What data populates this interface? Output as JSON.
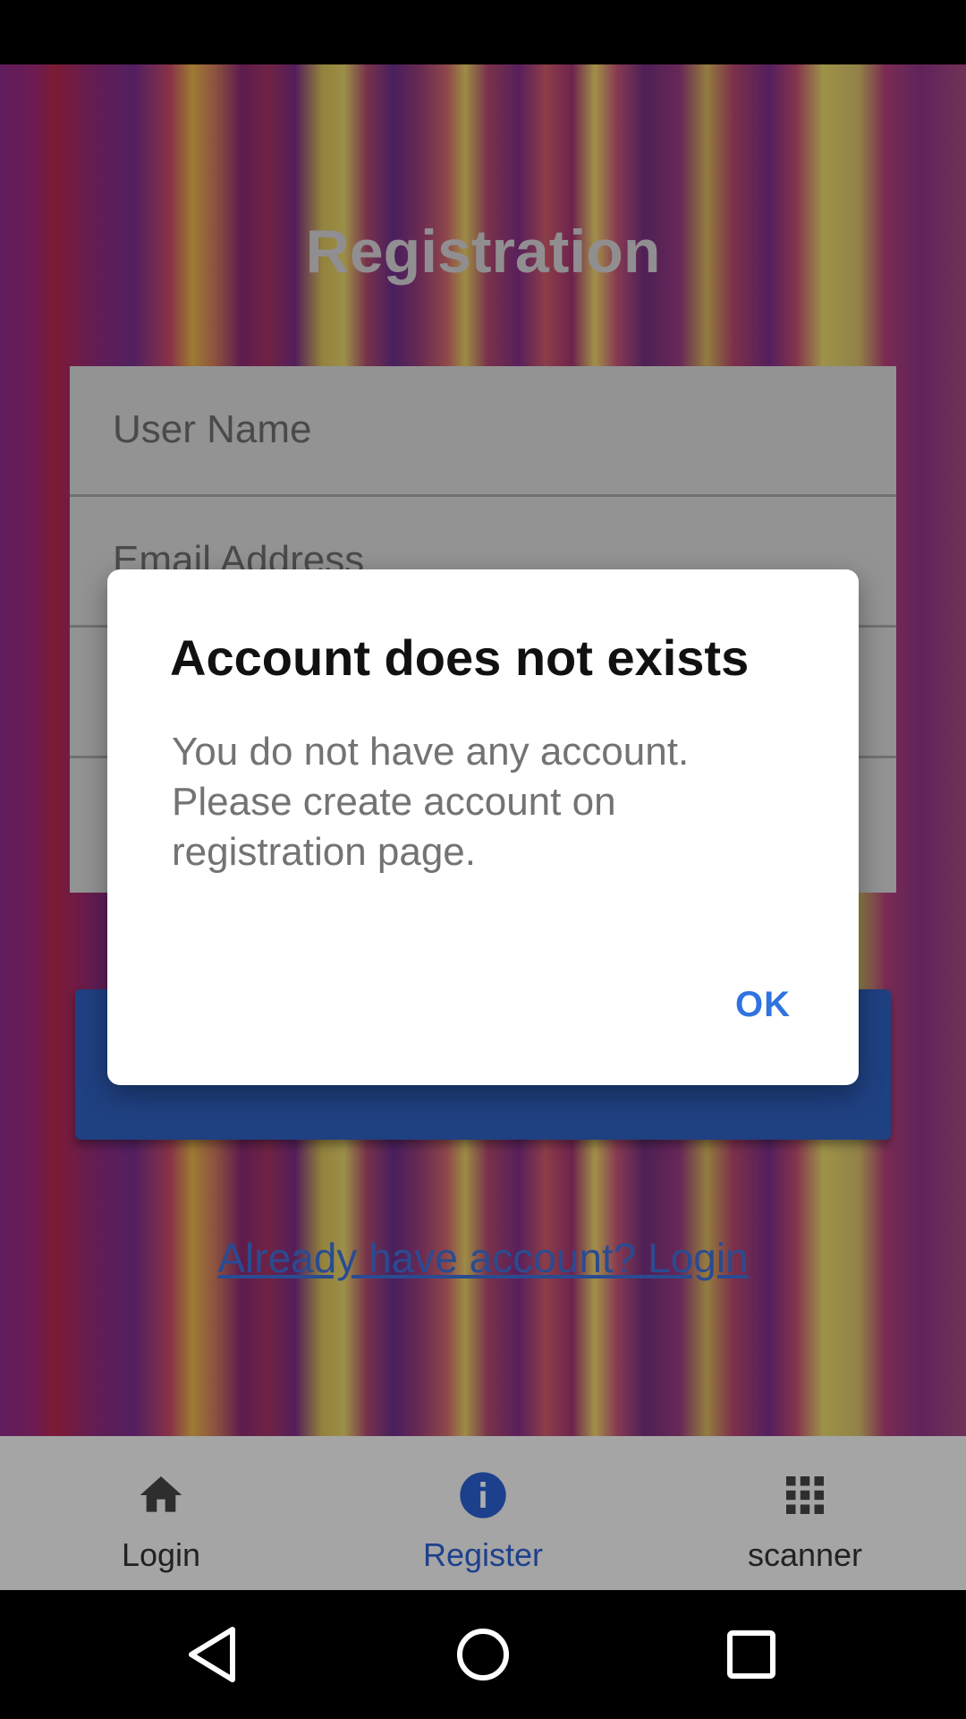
{
  "page": {
    "title": "Registration"
  },
  "form": {
    "username_placeholder": "User Name",
    "email_placeholder": "Email Address"
  },
  "links": {
    "login_link": "Already have account? Login"
  },
  "bottom_nav": {
    "items": [
      {
        "label": "Login",
        "icon": "home-icon",
        "active": false
      },
      {
        "label": "Register",
        "icon": "info-icon",
        "active": true
      },
      {
        "label": "scanner",
        "icon": "grid-icon",
        "active": false
      }
    ]
  },
  "dialog": {
    "title": "Account does not exists",
    "message": "You do not have any account. Please create account on registration page.",
    "ok_label": "OK"
  },
  "colors": {
    "accent": "#2b5fce",
    "button_blue": "#2f5fbf",
    "link_blue": "#3f6fd6"
  }
}
